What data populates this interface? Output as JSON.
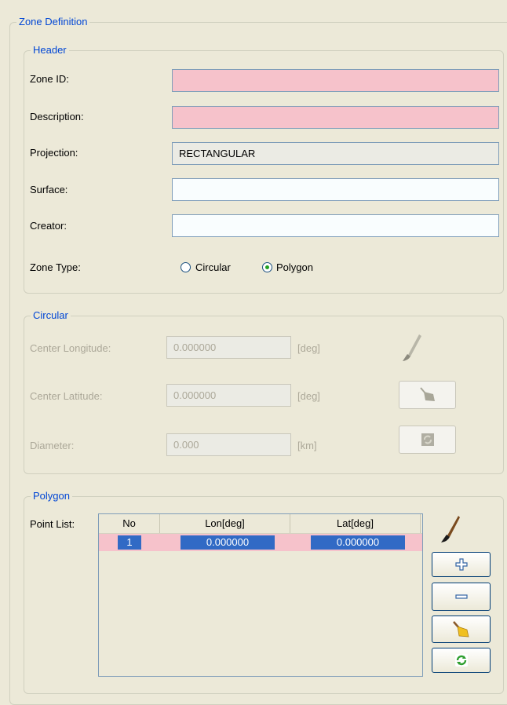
{
  "zone_definition": {
    "legend": "Zone Definition"
  },
  "header": {
    "legend": "Header",
    "zone_id_label": "Zone ID:",
    "zone_id_value": "",
    "description_label": "Description:",
    "description_value": "",
    "projection_label": "Projection:",
    "projection_value": "RECTANGULAR",
    "surface_label": "Surface:",
    "surface_value": "",
    "creator_label": "Creator:",
    "creator_value": "",
    "zone_type_label": "Zone Type:",
    "zone_type_options": [
      "Circular",
      "Polygon"
    ],
    "zone_type_selected": "Polygon"
  },
  "circular": {
    "legend": "Circular",
    "center_longitude_label": "Center Longitude:",
    "center_longitude_value": "0.000000",
    "center_longitude_unit": "[deg]",
    "center_latitude_label": "Center Latitude:",
    "center_latitude_value": "0.000000",
    "center_latitude_unit": "[deg]",
    "diameter_label": "Diameter:",
    "diameter_value": "0.000",
    "diameter_unit": "[km]",
    "icons": [
      "brush-icon",
      "broom-icon",
      "refresh-icon"
    ]
  },
  "polygon": {
    "legend": "Polygon",
    "point_list_label": "Point List:",
    "columns": [
      "No",
      "Lon[deg]",
      "Lat[deg]"
    ],
    "rows": [
      {
        "no": "1",
        "lon": "0.000000",
        "lat": "0.000000"
      }
    ],
    "icons": [
      "brush-icon",
      "add-icon",
      "remove-icon",
      "broom-icon",
      "refresh-icon"
    ]
  },
  "colors": {
    "required_field": "#f6c2cb",
    "selection": "#316ac5",
    "legend_text": "#0046d5",
    "panel": "#ece9d8"
  }
}
